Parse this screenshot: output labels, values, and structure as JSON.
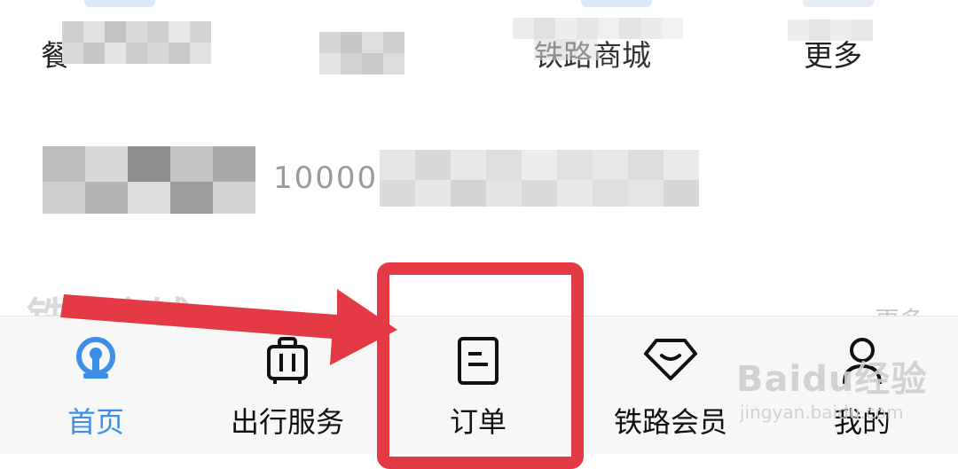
{
  "quick_entries": [
    {
      "label": "餐"
    },
    {
      "label": ""
    },
    {
      "label": "铁路商城"
    },
    {
      "label": "更多"
    }
  ],
  "banner": {
    "text": "10000"
  },
  "section": {
    "title": "铁路商城",
    "more": "更多"
  },
  "tabbar": {
    "active_color": "#3b8fe8",
    "tabs": [
      {
        "label": "首页",
        "icon": "railway-logo-icon",
        "active": true
      },
      {
        "label": "出行服务",
        "icon": "luggage-icon",
        "active": false
      },
      {
        "label": "订单",
        "icon": "order-document-icon",
        "active": false
      },
      {
        "label": "铁路会员",
        "icon": "diamond-icon",
        "active": false
      },
      {
        "label": "我的",
        "icon": "user-icon",
        "active": false
      }
    ]
  },
  "annotation": {
    "color": "#e43a45"
  },
  "watermark": {
    "main": "Baidu经验",
    "sub": "jingyan.baidu.com"
  }
}
